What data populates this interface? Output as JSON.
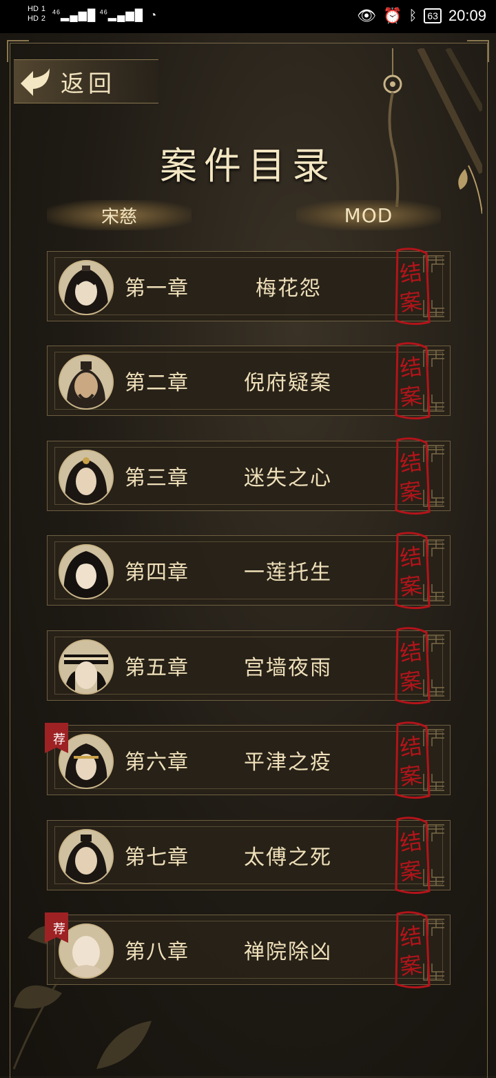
{
  "status_bar": {
    "network_1": "HD",
    "network_2": "HD",
    "sim1": "1",
    "sim2": "2",
    "signal_1": "46",
    "signal_2": "46",
    "battery": "63",
    "time": "20:09"
  },
  "header": {
    "back_label": "返回",
    "title": "案件目录"
  },
  "tabs": [
    {
      "label": "宋慈"
    },
    {
      "label": "MOD"
    }
  ],
  "chapters": [
    {
      "chapter": "第一章",
      "title": "梅花怨",
      "status": "结案",
      "recommended": false,
      "avatar": "scholar-portrait"
    },
    {
      "chapter": "第二章",
      "title": "倪府疑案",
      "status": "结案",
      "recommended": false,
      "avatar": "elder-portrait"
    },
    {
      "chapter": "第三章",
      "title": "迷失之心",
      "status": "结案",
      "recommended": false,
      "avatar": "youth-portrait"
    },
    {
      "chapter": "第四章",
      "title": "一莲托生",
      "status": "结案",
      "recommended": false,
      "avatar": "lady-portrait"
    },
    {
      "chapter": "第五章",
      "title": "宫墙夜雨",
      "status": "结案",
      "recommended": false,
      "avatar": "official-portrait"
    },
    {
      "chapter": "第六章",
      "title": "平津之疫",
      "status": "结案",
      "recommended": true,
      "badge": "荐",
      "avatar": "swordsman-portrait"
    },
    {
      "chapter": "第七章",
      "title": "太傅之死",
      "status": "结案",
      "recommended": false,
      "avatar": "tutor-portrait"
    },
    {
      "chapter": "第八章",
      "title": "禅院除凶",
      "status": "结案",
      "recommended": true,
      "badge": "荐",
      "avatar": "monk-portrait"
    }
  ],
  "colors": {
    "accent_gold": "#efe0ba",
    "stamp_red": "#b3141a",
    "badge_red": "#9e2224",
    "card_bg": "#282218"
  }
}
